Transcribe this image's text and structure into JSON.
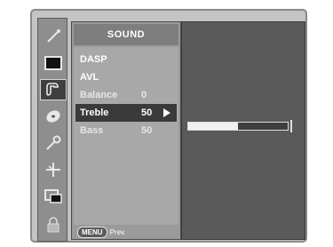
{
  "menu": {
    "title": "SOUND",
    "items": [
      {
        "label": "DASP",
        "value": ""
      },
      {
        "label": "AVL",
        "value": ""
      },
      {
        "label": "Balance",
        "value": "0"
      },
      {
        "label": "Treble",
        "value": "50"
      },
      {
        "label": "Bass",
        "value": "50"
      }
    ],
    "selected_index": 3,
    "footer_button": "MENU",
    "footer_text": "Prev."
  },
  "icons": [
    "picture-wand-icon",
    "screen-icon",
    "sound-icon",
    "disc-icon",
    "key-icon",
    "cross-icon",
    "pip-icon",
    "lock-icon"
  ],
  "selected_icon": "sound-icon",
  "treble_slider": {
    "value": 50,
    "max": 100
  },
  "colors": {
    "selection": "#3a3a3a",
    "panel": "#5a5a5a",
    "menu": "#a8a8a8"
  }
}
